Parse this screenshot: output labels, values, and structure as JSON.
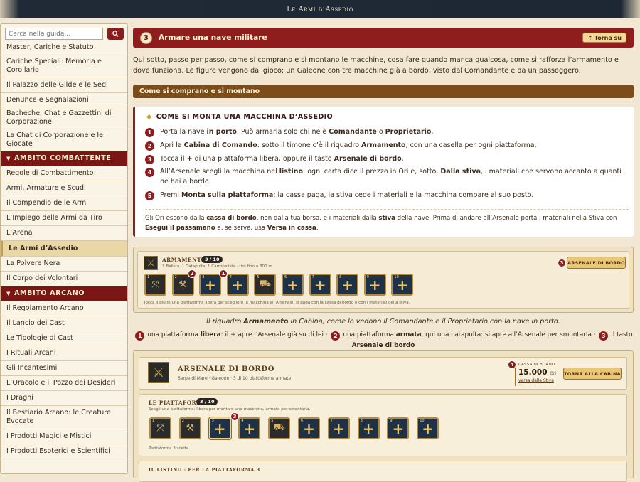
{
  "window": {
    "title": "Le Armi d’Assedio"
  },
  "sidebar": {
    "search_placeholder": "Cerca nella guida...",
    "search_icon": "magnifier-icon",
    "items": [
      {
        "label": "Master, Cariche e Statuto",
        "type": "link"
      },
      {
        "label": "Cariche Speciali: Memoria e Corollario",
        "type": "link"
      },
      {
        "label": "Il Palazzo delle Gilde e le Sedi",
        "type": "link"
      },
      {
        "label": "Denunce e Segnalazioni",
        "type": "link"
      },
      {
        "label": "Bacheche, Chat e Gazzettini di Corporazione",
        "type": "link"
      },
      {
        "label": "La Chat di Corporazione e le Giocate",
        "type": "link"
      },
      {
        "label": "AMBITO COMBATTENTE",
        "type": "section"
      },
      {
        "label": "Regole di Combattimento",
        "type": "link"
      },
      {
        "label": "Armi, Armature e Scudi",
        "type": "link"
      },
      {
        "label": "Il Compendio delle Armi",
        "type": "link"
      },
      {
        "label": "L’Impiego delle Armi da Tiro",
        "type": "link"
      },
      {
        "label": "L’Arena",
        "type": "link"
      },
      {
        "label": "Le Armi d’Assedio",
        "type": "active"
      },
      {
        "label": "La Polvere Nera",
        "type": "link"
      },
      {
        "label": "Il Corpo dei Volontari",
        "type": "link"
      },
      {
        "label": "AMBITO ARCANO",
        "type": "section"
      },
      {
        "label": "Il Regolamento Arcano",
        "type": "link"
      },
      {
        "label": "Il Lancio dei Cast",
        "type": "link"
      },
      {
        "label": "Le Tipologie di Cast",
        "type": "link"
      },
      {
        "label": "I Rituali Arcani",
        "type": "link"
      },
      {
        "label": "Gli Incantesimi",
        "type": "link"
      },
      {
        "label": "L’Oracolo e il Pozzo dei Desideri",
        "type": "link"
      },
      {
        "label": "I Draghi",
        "type": "link"
      },
      {
        "label": "Il Bestiario Arcano: le Creature Evocate",
        "type": "link"
      },
      {
        "label": "I Prodotti Magici e Mistici",
        "type": "link"
      },
      {
        "label": "I Prodotti Esoterici e Scientifici",
        "type": "link"
      }
    ]
  },
  "header": {
    "number": "3",
    "title": "Armare una nave militare",
    "back_label": "↑ Torna su"
  },
  "intro": "Qui sotto, passo per passo, come si comprano e si montano le macchine, cosa fare quando manca qualcosa, come si rafforza l’armamento e dove funziona. Le figure vengono dal gioco: un Galeone con tre macchine già a bordo, visto dal Comandante e da un passeggero.",
  "section_bar": "Come si comprano e si montano",
  "howto": {
    "title": "COME SI MONTA UNA MACCHINA D’ASSEDIO",
    "steps": [
      {
        "n": "1",
        "html": "Porta la nave <b>in porto</b>. Può armarla solo chi ne è <b>Comandante</b> o <b>Proprietario</b>."
      },
      {
        "n": "2",
        "html": "Apri la <b>Cabina di Comando</b>: sotto il timone c’è il riquadro <b>Armamento</b>, con una casella per ogni piattaforma."
      },
      {
        "n": "3",
        "html": "Tocca il <b>+</b> di una piattaforma libera, oppure il tasto <b>Arsenale di bordo</b>."
      },
      {
        "n": "4",
        "html": "All’Arsenale scegli la macchina nel <b>listino</b>: ogni carta dice il prezzo in Ori e, sotto, <b>Dalla stiva</b>, i materiali che servono accanto a quanti ne hai a bordo."
      },
      {
        "n": "5",
        "html": "Premi <b>Monta sulla piattaforma</b>: la cassa paga, la stiva cede i materiali e la macchina compare al suo posto."
      }
    ],
    "note_html": "Gli Ori escono dalla <b>cassa di bordo</b>, non dalla tua borsa, e i materiali dalla <b>stiva</b> della nave. Prima di andare all’Arsenale porta i materiali nella Stiva con <b>Esegui il passamano</b> e, se serve, usa <b>Versa in cassa</b>."
  },
  "figure1": {
    "title": "ARMAMENTO",
    "count": "3 / 10",
    "desc": "1 Balista, 1 Catapulta, 1 Carrobalista · tiro fino a 300 m",
    "button": "ARSENALE DI BORDO",
    "hint": "Tocca il più di una piattaforma libera per scegliere la macchina all’Arsenale: si paga con la cassa di bordo e con i materiali della stiva.",
    "slots": [
      {
        "i": "1",
        "state": "armed",
        "icon": "ballista-icon"
      },
      {
        "i": "2",
        "state": "armed",
        "icon": "catapult-icon"
      },
      {
        "i": "3",
        "state": "free"
      },
      {
        "i": "4",
        "state": "free"
      },
      {
        "i": "5",
        "state": "armed",
        "icon": "carroballista-icon"
      },
      {
        "i": "6",
        "state": "free"
      },
      {
        "i": "7",
        "state": "free"
      },
      {
        "i": "8",
        "state": "free"
      },
      {
        "i": "9",
        "state": "free"
      },
      {
        "i": "10",
        "state": "free"
      }
    ],
    "markers": [
      "1",
      "2",
      "3"
    ]
  },
  "caption_html": "Il riquadro <b>Armamento</b> in Cabina, come lo vedono il Comandante e il Proprietario con la nave in porto.",
  "legend": [
    {
      "n": "1",
      "html": "una piattaforma <b>libera</b>: il + apre l’Arsenale già su di lei ·"
    },
    {
      "n": "2",
      "html": "una piattaforma <b>armata</b>, qui una catapulta: si apre all’Arsenale per smontarla ·"
    },
    {
      "n": "3",
      "html": "il tasto <b>Arsenale di bordo</b>"
    }
  ],
  "figure2": {
    "title": "ARSENALE DI BORDO",
    "subtitle": "Serpe di Mare · Galeone · 3 di 10 piattaforme armate",
    "cassa_label": "CASSA DI BORDO",
    "cassa_value": "15.000",
    "cassa_unit": "Ori",
    "cassa_link": "versa dalla Stiva",
    "back_button": "TORNA ALLA CABINA",
    "platforms_title": "LE PIATTAFORME",
    "platforms_count": "3 / 10",
    "platforms_desc": "Scegli una piattaforma: libera per montare una macchina, armata per smontarla.",
    "selected_note": "Piattaforma 3 scelta.",
    "list_title": "IL LISTINO · PER LA PIATTAFORMA 3",
    "markers": [
      "3",
      "4"
    ]
  }
}
